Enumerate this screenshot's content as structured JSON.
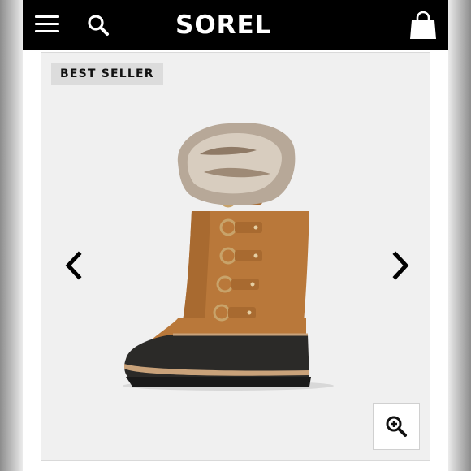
{
  "header": {
    "brand": "SOREL",
    "icons": {
      "menu": "hamburger-menu-icon",
      "search": "search-icon",
      "cart": "shopping-bag-icon"
    }
  },
  "product": {
    "badge": "BEST SELLER",
    "image": "brown-suede-winter-boot-with-fur-cuff",
    "nav": {
      "prev": "chevron-left-icon",
      "next": "chevron-right-icon"
    },
    "zoom": "zoom-in-icon"
  },
  "colors": {
    "header_bg": "#000000",
    "badge_bg": "#dcdcdc",
    "panel_bg": "#f0f0f0",
    "boot_suede": "#b9783a",
    "boot_rubber": "#2b2a28"
  }
}
